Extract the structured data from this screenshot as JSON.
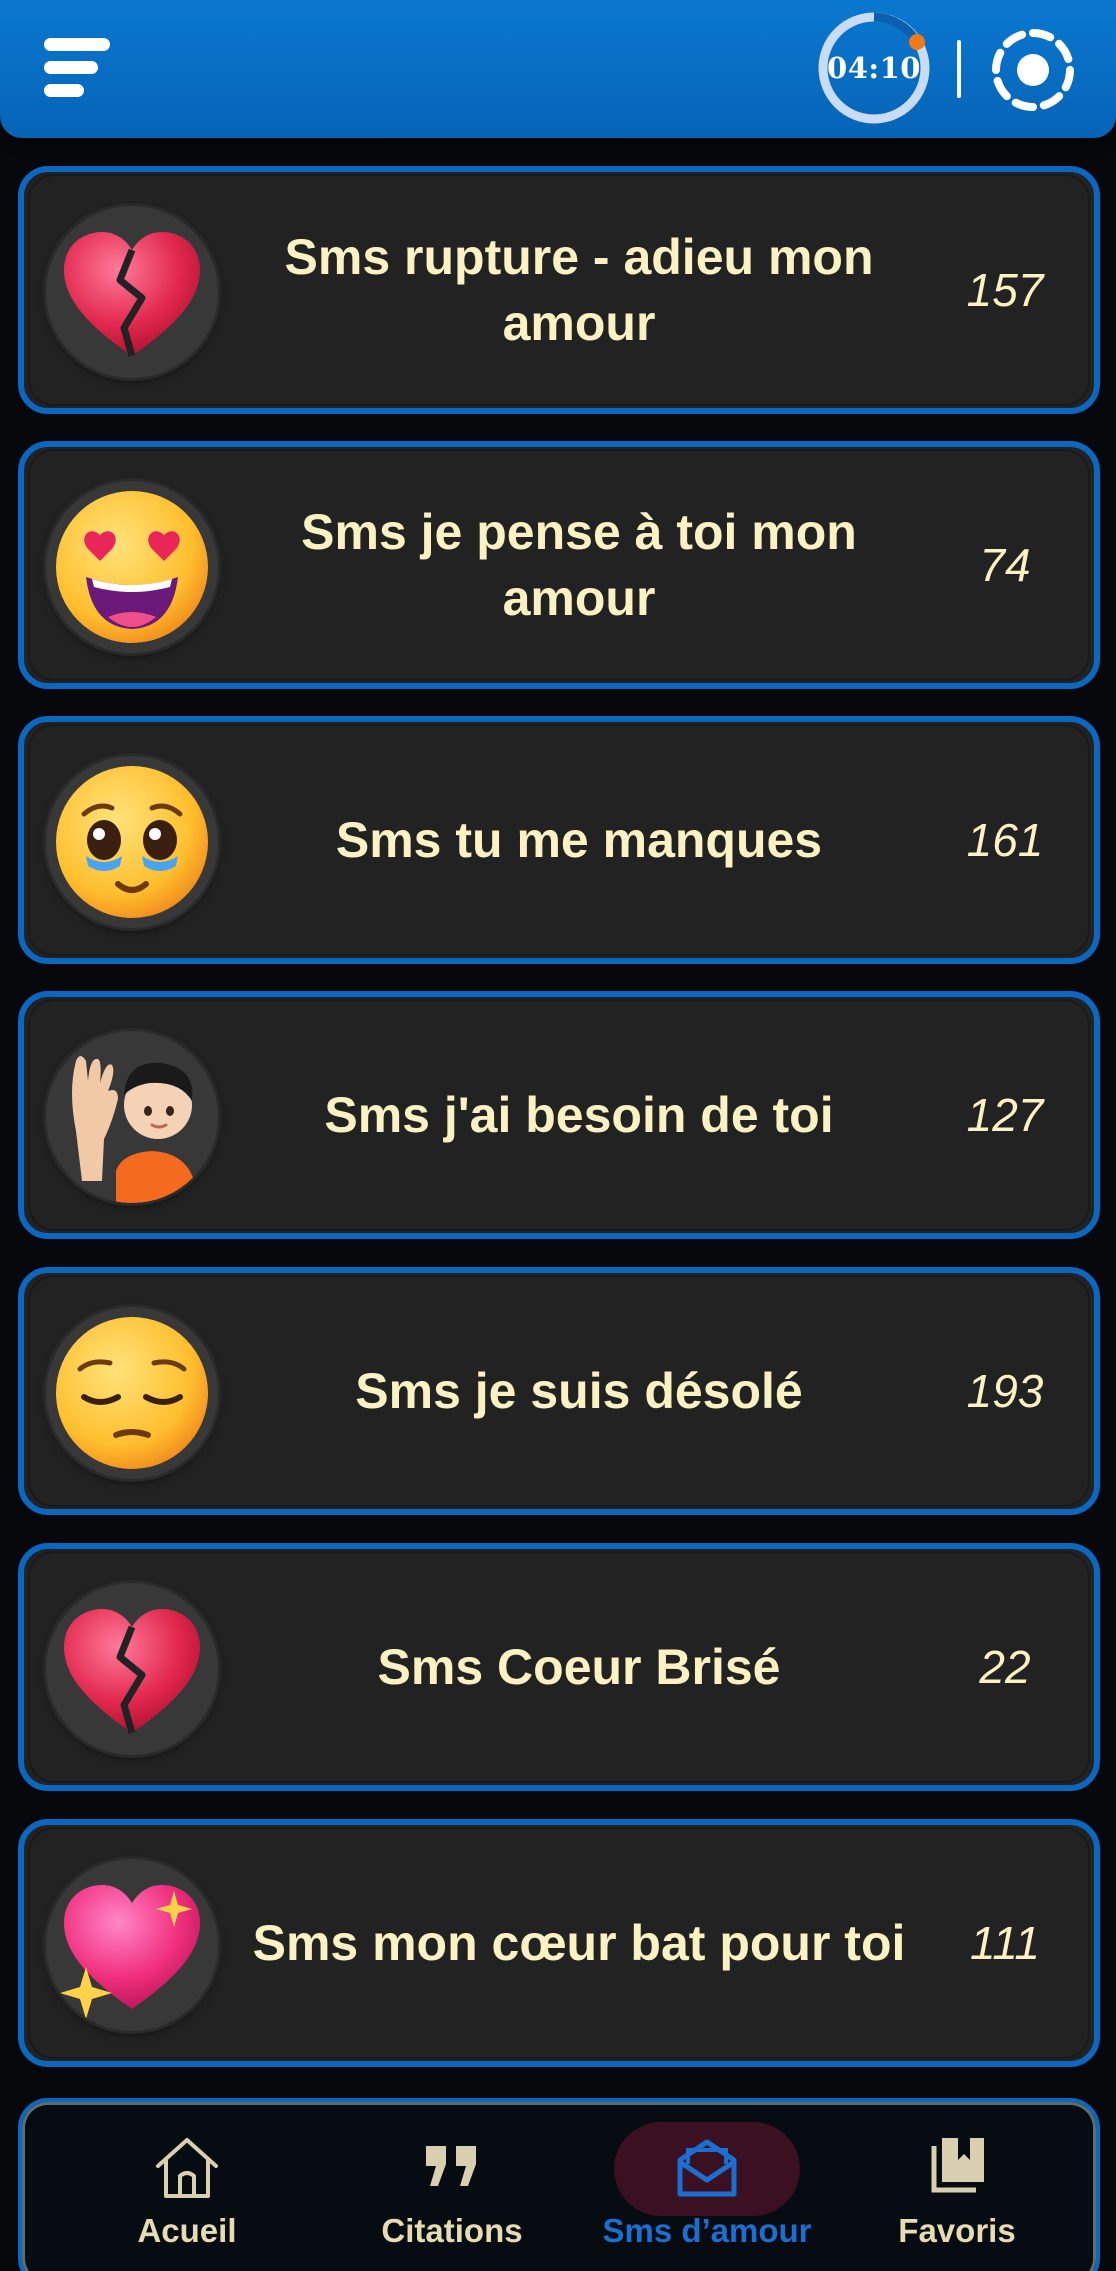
{
  "header": {
    "timer": "04:10",
    "timer_progress": 0.96,
    "menu_icon": "menu-icon",
    "settings_icon": "settings-icon"
  },
  "categories": [
    {
      "title": "Sms rupture - adieu mon amour",
      "count": "157",
      "emoji": "broken-heart"
    },
    {
      "title": "Sms je pense à toi mon amour",
      "count": "74",
      "emoji": "heart-eyes"
    },
    {
      "title": "Sms tu me manques",
      "count": "161",
      "emoji": "holding-back-tears"
    },
    {
      "title": "Sms j'ai besoin de toi",
      "count": "127",
      "emoji": "person-raising-hand"
    },
    {
      "title": "Sms je suis désolé",
      "count": "193",
      "emoji": "pensive-face"
    },
    {
      "title": "Sms Coeur Brisé",
      "count": "22",
      "emoji": "broken-heart"
    },
    {
      "title": "Sms mon cœur bat pour toi",
      "count": "111",
      "emoji": "sparkling-heart"
    }
  ],
  "nav": {
    "items": [
      {
        "label": "Acueil",
        "icon": "home-icon",
        "active": false
      },
      {
        "label": "Citations",
        "icon": "quote-icon",
        "active": false
      },
      {
        "label": "Sms d’amour",
        "icon": "mail-icon",
        "active": true
      },
      {
        "label": "Favoris",
        "icon": "bookmark-icon",
        "active": false
      }
    ]
  },
  "colors": {
    "header": "#0a78d0",
    "card_border": "#0c67c0",
    "card_bg": "#222222",
    "text": "#fbf2c4",
    "nav_active": "#1a6fd1",
    "timer_dot": "#f07a1a"
  }
}
